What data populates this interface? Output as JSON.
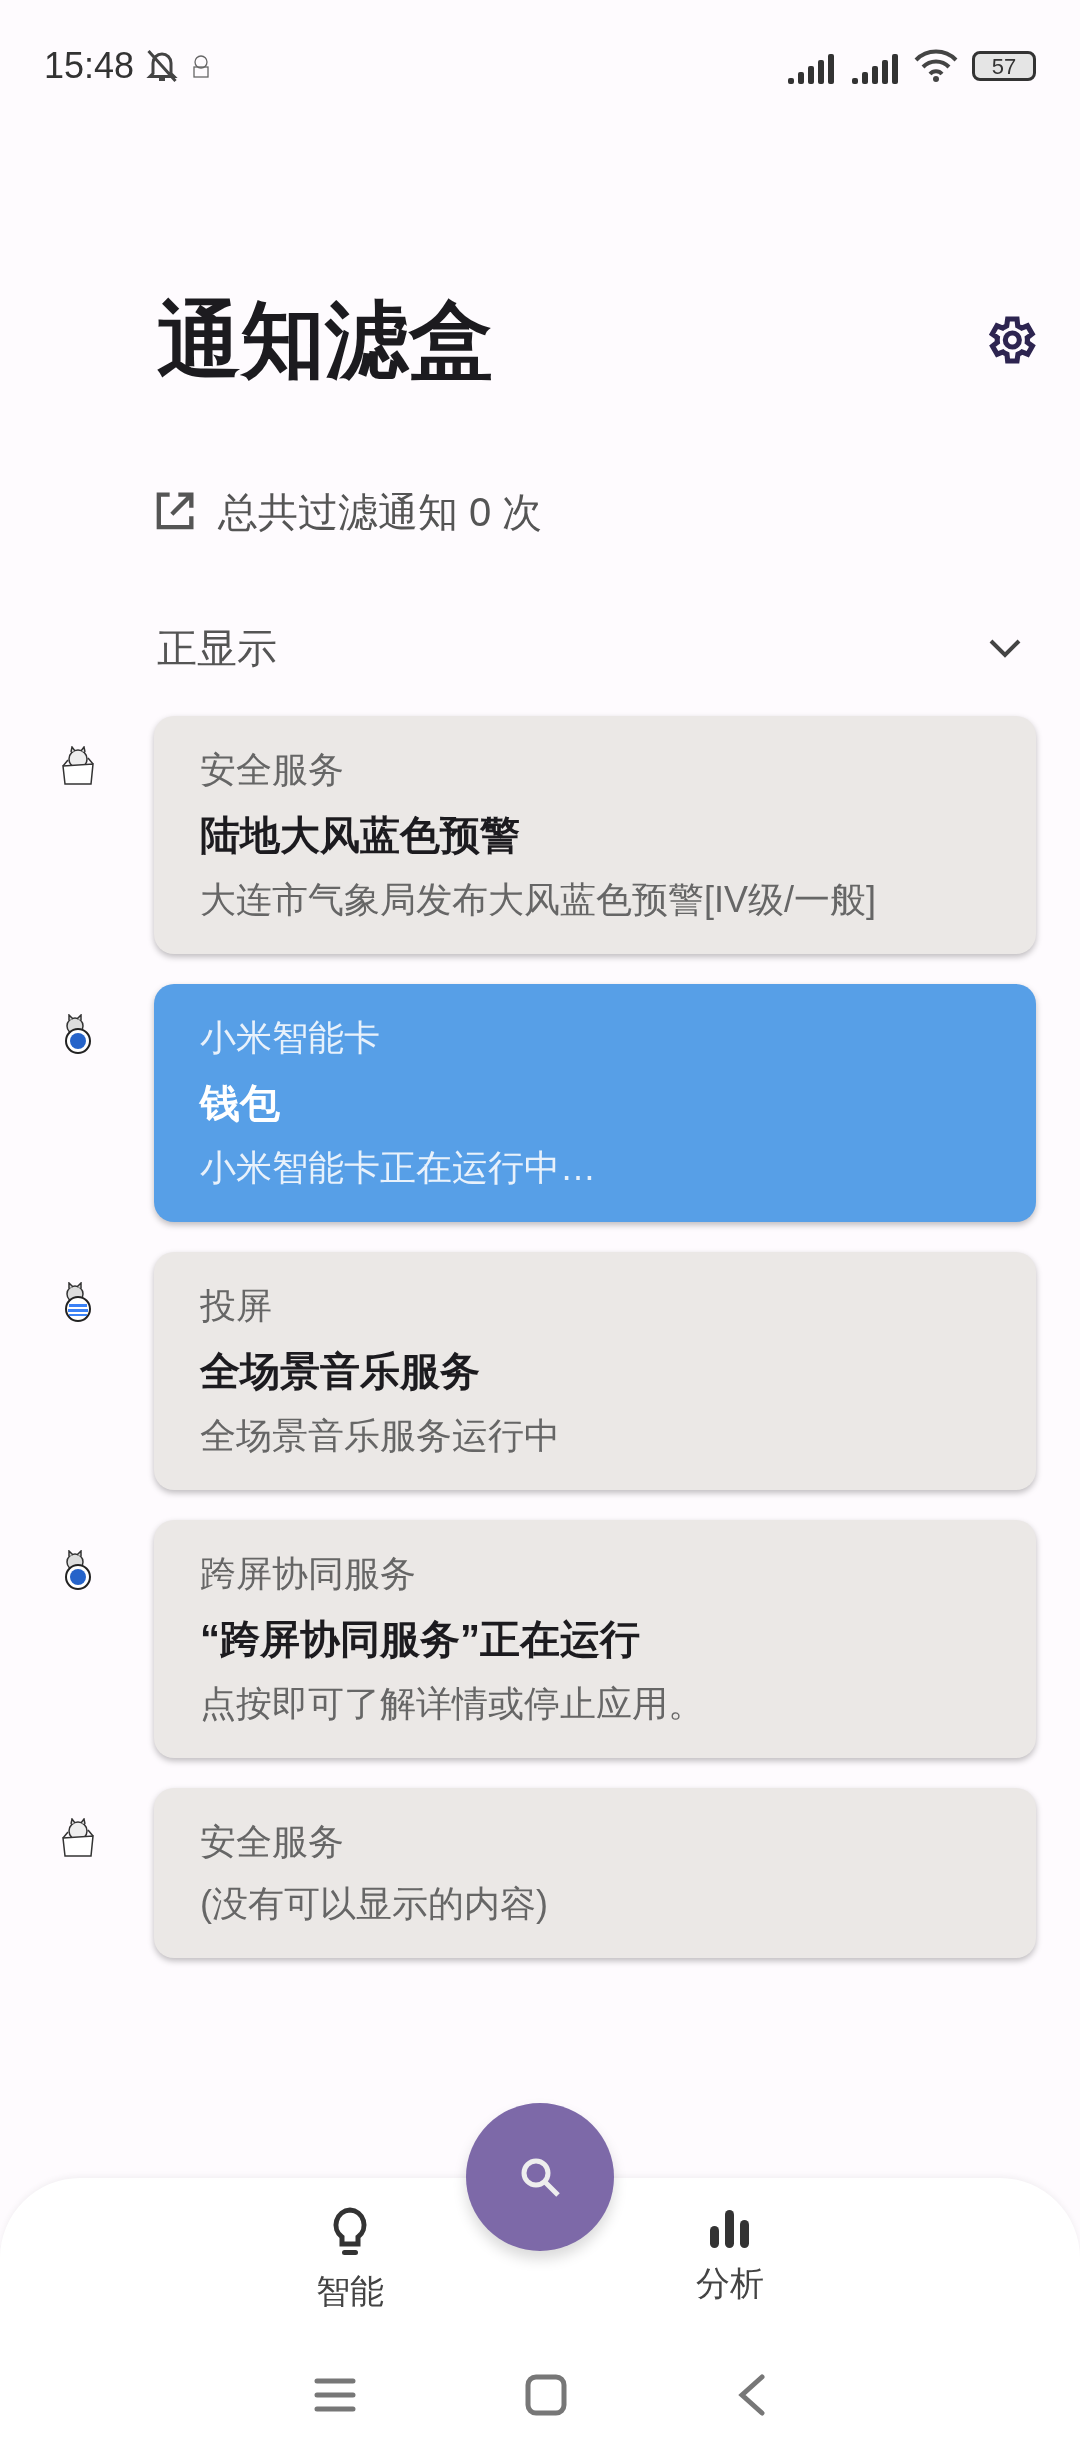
{
  "status_bar": {
    "time": "15:48",
    "battery": "57"
  },
  "header": {
    "title": "通知滤盒"
  },
  "summary": {
    "text": "总共过滤通知 0 次"
  },
  "section": {
    "label": "正显示",
    "expanded": true
  },
  "notifications": [
    {
      "app": "安全服务",
      "title": "陆地大风蓝色预警",
      "body": "大连市气象局发布大风蓝色预警[IV级/一般]",
      "selected": false,
      "kind": "box"
    },
    {
      "app": "小米智能卡",
      "title": "钱包",
      "body": "小米智能卡正在运行中…",
      "selected": true,
      "kind": "ball"
    },
    {
      "app": "投屏",
      "title": "全场景音乐服务",
      "body": "全场景音乐服务运行中",
      "selected": false,
      "kind": "stripes"
    },
    {
      "app": "跨屏协同服务",
      "title": "“跨屏协同服务”正在运行",
      "body": "点按即可了解详情或停止应用。",
      "selected": false,
      "kind": "ball"
    },
    {
      "app": "安全服务",
      "body": "(没有可以显示的内容)",
      "selected": false,
      "kind": "box"
    }
  ],
  "bottom_nav": [
    {
      "label": "智能",
      "kind": "bulb"
    },
    {
      "label": "分析",
      "kind": "bars"
    }
  ]
}
